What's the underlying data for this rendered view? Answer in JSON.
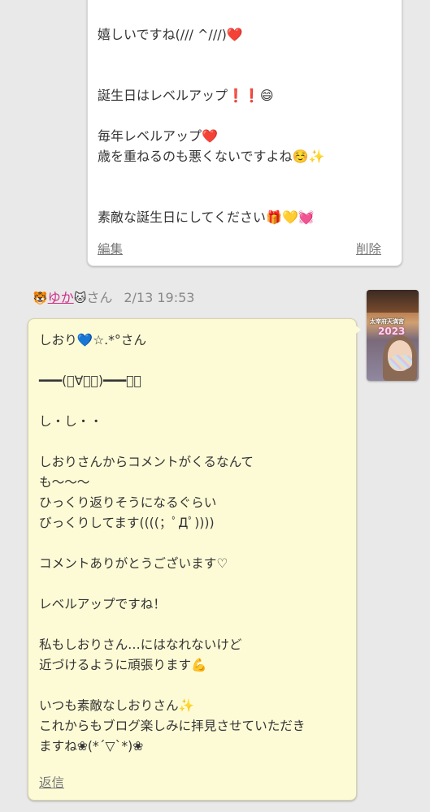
{
  "owner_reply": {
    "text": "嬉しいですね(/// ^///)❤️\n\n\n誕生日はレベルアップ❗️❗️😄\n\n毎年レベルアップ❤️\n歳を重ねるのも悪くないですよね☺️✨\n\n\n素敵な誕生日にしてください🎁💛💓",
    "edit_label": "編集",
    "delete_label": "削除"
  },
  "comment": {
    "prefix_emoji": "🐯",
    "name": "ゆか",
    "suffix_emoji": "🐱",
    "honorific": "さん",
    "timestamp": "2/13 19:53",
    "avatar_caption": "太宰府天満宮",
    "avatar_year": "2023",
    "text": "しおり💙☆.*°さん\n\n━━━(ﾟ∀ﾟ；)━━━・・\n\nし・し・・\n\nしおりさんからコメントがくるなんて\nも〜〜〜\nひっくり返りそうになるぐらい\nびっくりしてます((((；ﾟДﾟ))))\n\nコメントありがとうございます♡\n\nレベルアップですね！\n\n私もしおりさん…にはなれないけど\n近づけるように頑張ります💪\n\nいつも素敵なしおりさん✨\nこれからもブログ楽しみに拝見させていただき\nますね❀(*´▽`*)❀",
    "reply_label": "返信"
  },
  "colors": {
    "background": "#e9e9e9",
    "owner_bubble": "#ffffff",
    "comment_bubble": "#fdfbd6",
    "name_link": "#cc2e87",
    "meta_gray": "#888888"
  }
}
